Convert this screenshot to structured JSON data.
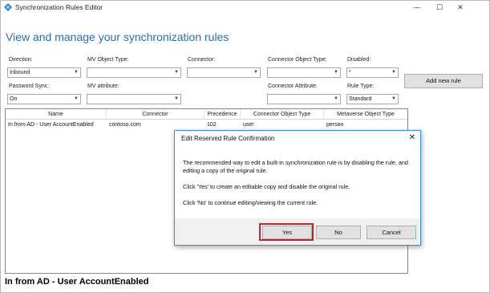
{
  "window": {
    "title": "Synchronization Rules Editor",
    "controls": {
      "minimize": "—",
      "maximize": "☐",
      "close": "✕"
    }
  },
  "heading": "View and manage your synchronization rules",
  "filters": {
    "direction": {
      "label": "Direction:",
      "value": "Inbound"
    },
    "mv_object_type": {
      "label": "MV Object Type:",
      "value": ""
    },
    "connector": {
      "label": "Connector:",
      "value": ""
    },
    "connector_object_type": {
      "label": "Connector Object Type:",
      "value": ""
    },
    "disabled": {
      "label": "Disabled:",
      "value": "*"
    },
    "password_sync": {
      "label": "Password Sync:",
      "value": "On"
    },
    "mv_attribute": {
      "label": "MV attribute:",
      "value": ""
    },
    "connector_attribute": {
      "label": "Connector Attribute:",
      "value": ""
    },
    "rule_type": {
      "label": "Rule Type:",
      "value": "Standard"
    }
  },
  "add_new_rule_label": "Add new rule",
  "grid": {
    "columns": [
      "Name",
      "Connector",
      "Precedence",
      "Connector Object Type",
      "Metaverse Object Type"
    ],
    "rows": [
      [
        "In from AD - User AccountEnabled",
        "contoso.com",
        "102",
        "user",
        "person"
      ]
    ]
  },
  "status_text": "In from AD - User AccountEnabled",
  "dialog": {
    "title": "Edit Reserved Rule Confirmation",
    "message_1": "The recommended way to edit a built-in synchronization rule is by disabling the rule, and editing a copy of the original rule.",
    "message_2": "Click 'Yes' to create an editable copy and disable the original rule.",
    "message_3": "Click 'No' to continue editing/viewing the current rule.",
    "yes_label": "Yes",
    "no_label": "No",
    "cancel_label": "Cancel",
    "close_glyph": "✕"
  },
  "colors": {
    "heading": "#2a6ead",
    "highlight": "#c0272d",
    "dialog_border": "#3c8ee0"
  }
}
